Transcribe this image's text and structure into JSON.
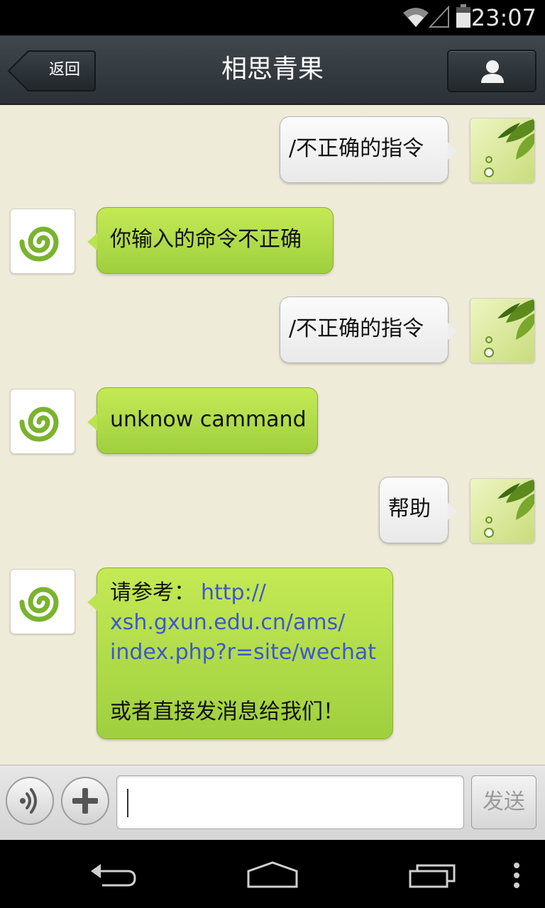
{
  "status_bar": {
    "time": "23:07",
    "icons": [
      "wifi-icon",
      "cell-signal-icon",
      "battery-icon"
    ]
  },
  "header": {
    "title": "相思青果",
    "back_label": "返回",
    "profile_icon": "person-icon"
  },
  "messages": [
    {
      "sender": "me",
      "text": "/不正确的指令"
    },
    {
      "sender": "bot",
      "text": "你输入的命令不正确"
    },
    {
      "sender": "me",
      "text": "/不正确的指令"
    },
    {
      "sender": "bot",
      "text": "unknow cammand"
    },
    {
      "sender": "me",
      "text": "帮助"
    },
    {
      "sender": "bot",
      "lines": [
        "请参考：",
        "http://",
        "xsh.gxun.edu.cn/ams/",
        "index.php?r=site/wechat",
        "或者直接发消息给我们！"
      ]
    }
  ],
  "input_bar": {
    "voice_icon": "voice-icon",
    "plus_icon": "plus-icon",
    "input_value": "",
    "send_label": "发送"
  },
  "nav_bar": {
    "icons": [
      "back-nav-icon",
      "home-icon",
      "recents-icon",
      "menu-icon"
    ]
  },
  "colors": {
    "chat_bg": "#efebd9",
    "bot_bubble": "#b4e04e",
    "me_bubble": "#f4f4f4",
    "link": "#3e58c9",
    "header": "#353c42"
  }
}
